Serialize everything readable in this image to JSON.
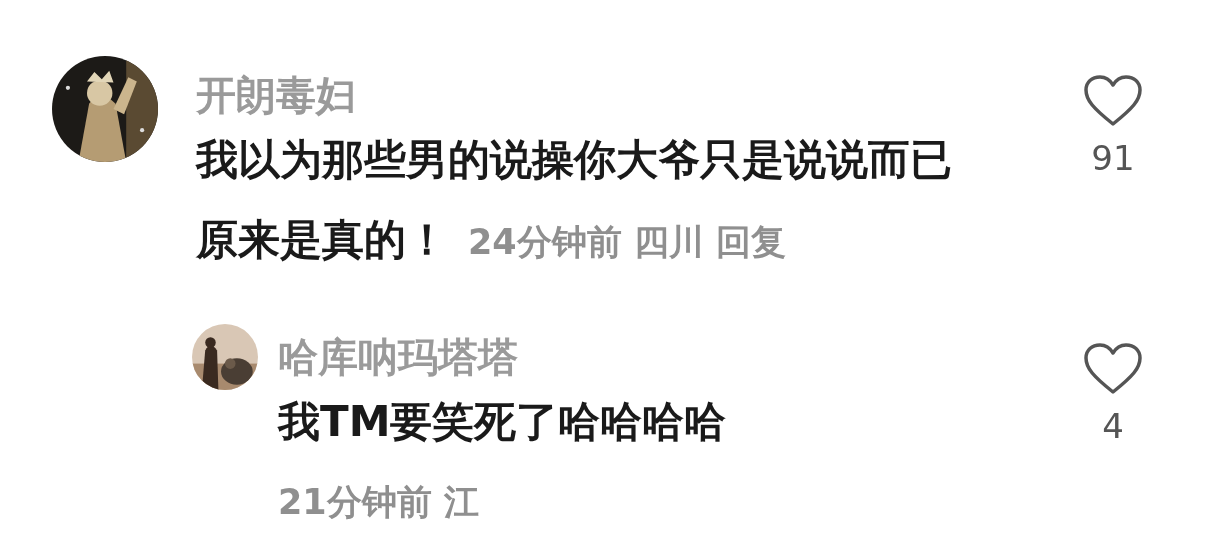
{
  "comments": [
    {
      "username": "开朗毒妇",
      "text_lines": [
        "我以为那些男的说操你大爷只是说说而已",
        "原来是真的！"
      ],
      "time": "24分钟前",
      "location": "四川",
      "reply": "回复",
      "likes": "91",
      "avatar": {
        "kind": "picture"
      }
    },
    {
      "username": "哈库呐玛塔塔",
      "text_lines": [
        "我TM要笑死了哈哈哈哈"
      ],
      "meta": "21分钟前 江",
      "likes": "4",
      "avatar": {
        "kind": "picture"
      }
    }
  ]
}
